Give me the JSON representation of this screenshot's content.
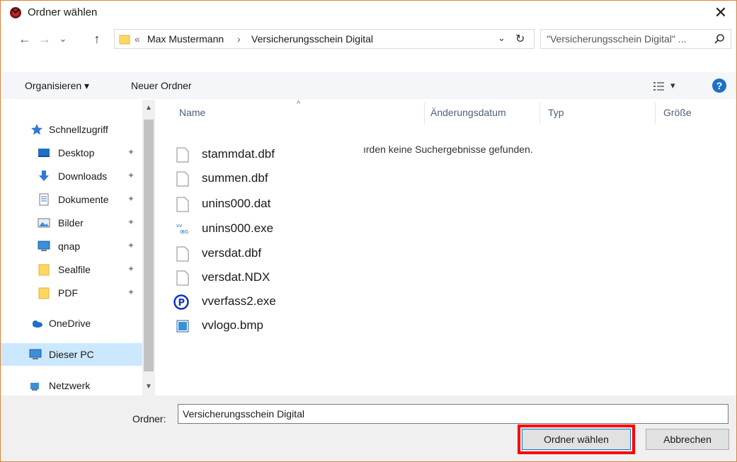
{
  "window": {
    "title": "Ordner wählen",
    "close_glyph": "✕"
  },
  "nav": {
    "back_glyph": "←",
    "forward_glyph": "→",
    "recent_glyph": "⌄",
    "up_glyph": "↑",
    "breadcrumb_overflow": "«",
    "breadcrumb_sep": "›",
    "path": [
      "Max Mustermann",
      "Versicherungsschein Digital"
    ],
    "dropdown_glyph": "⌄",
    "refresh_glyph": "↻",
    "search_placeholder": "\"Versicherungsschein Digital\" ..."
  },
  "toolbar": {
    "organize_label": "Organisieren ▾",
    "new_folder_label": "Neuer Ordner",
    "view_glyph": "▾",
    "help_glyph": "?"
  },
  "sidebar": {
    "items": [
      {
        "label": "Schnellzugriff",
        "icon": "star-icon",
        "pinned": false
      },
      {
        "label": "Desktop",
        "icon": "desktop-icon",
        "pinned": true
      },
      {
        "label": "Downloads",
        "icon": "download-icon",
        "pinned": true
      },
      {
        "label": "Dokumente",
        "icon": "document-icon",
        "pinned": true
      },
      {
        "label": "Bilder",
        "icon": "pictures-icon",
        "pinned": true
      },
      {
        "label": "qnap",
        "icon": "monitor-icon",
        "pinned": true
      },
      {
        "label": "Sealfile",
        "icon": "folder-icon",
        "pinned": true
      },
      {
        "label": "PDF",
        "icon": "folder-icon",
        "pinned": true
      },
      {
        "label": "OneDrive",
        "icon": "cloud-icon",
        "pinned": false
      },
      {
        "label": "Dieser PC",
        "icon": "computer-icon",
        "pinned": false,
        "selected": true
      },
      {
        "label": "Netzwerk",
        "icon": "network-icon",
        "pinned": false
      }
    ],
    "pin_glyph": "📌",
    "scroll_up_glyph": "▲",
    "scroll_down_glyph": "▼"
  },
  "filelist": {
    "columns": [
      "Name",
      "Änderungsdatum",
      "Typ",
      "Größe"
    ],
    "sort_glyph": "^",
    "empty_message": "ırden keine Suchergebnisse gefunden.",
    "files": [
      {
        "name": "stammdat.dbf",
        "icon": "file-icon"
      },
      {
        "name": "summen.dbf",
        "icon": "file-icon"
      },
      {
        "name": "unins000.dat",
        "icon": "file-icon"
      },
      {
        "name": "unins000.exe",
        "icon": "installer-icon"
      },
      {
        "name": "versdat.dbf",
        "icon": "file-icon"
      },
      {
        "name": "versdat.NDX",
        "icon": "file-icon"
      },
      {
        "name": "vverfass2.exe",
        "icon": "app-p-icon"
      },
      {
        "name": "vvlogo.bmp",
        "icon": "bitmap-icon"
      }
    ]
  },
  "bottom": {
    "folder_label": "Ordner:",
    "folder_value": "Versicherungsschein Digital",
    "select_button": "Ordner wählen",
    "cancel_button": "Abbrechen"
  },
  "colors": {
    "accent": "#0078d7",
    "highlight": "#ff0000",
    "selected_bg": "#cce8ff",
    "window_border": "#d9853b"
  }
}
